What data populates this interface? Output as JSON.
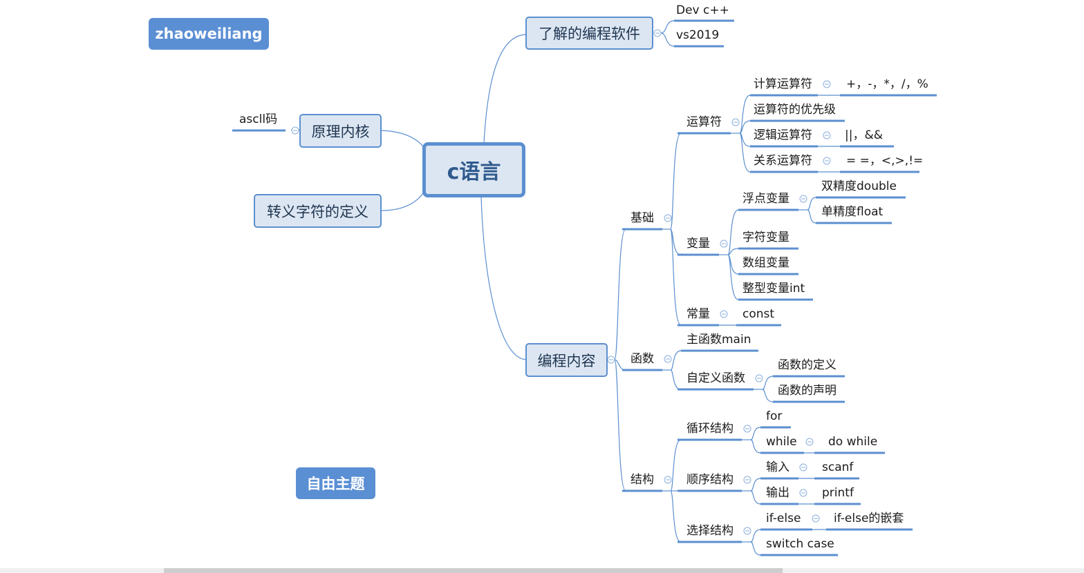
{
  "colors": {
    "line": "#5b8fcf",
    "node_fill": "#dce6f2",
    "floating_fill": "#5b8fd4"
  },
  "floating_topics": {
    "author": "zhaoweiliang",
    "free_topic": "自由主题"
  },
  "central": "c语言",
  "left": {
    "principle": {
      "label": "原理内核",
      "children": [
        "ascll码"
      ]
    },
    "escape": {
      "label": "转义字符的定义"
    }
  },
  "software": {
    "label": "了解的编程软件",
    "children": [
      "Dev c++",
      "vs2019"
    ]
  },
  "content": {
    "label": "编程内容",
    "basics": {
      "label": "基础",
      "operators": {
        "label": "运算符",
        "arith": {
          "label": "计算运算符",
          "value": "+，-，*，/，%"
        },
        "priority": "运算符的优先级",
        "logic": {
          "label": "逻辑运算符",
          "value": "||，&&"
        },
        "relation": {
          "label": "关系运算符",
          "value": "= =，<,>,!="
        }
      },
      "variables": {
        "label": "变量",
        "float": {
          "label": "浮点变量",
          "children": [
            "双精度double",
            "单精度float"
          ]
        },
        "char": "字符变量",
        "array": "数组变量",
        "int": "整型变量int"
      },
      "constants": {
        "label": "常量",
        "value": "const"
      }
    },
    "functions": {
      "label": "函数",
      "main": "主函数main",
      "custom": {
        "label": "自定义函数",
        "children": [
          "函数的定义",
          "函数的声明"
        ]
      }
    },
    "structures": {
      "label": "结构",
      "loop": {
        "label": "循环结构",
        "for": "for",
        "while": "while",
        "do_while": "do while"
      },
      "sequence": {
        "label": "顺序结构",
        "input": "输入",
        "scanf": "scanf",
        "output": "输出",
        "printf": "printf"
      },
      "selection": {
        "label": "选择结构",
        "if_else": "if-else",
        "nested": "if-else的嵌套",
        "switch": "switch case"
      }
    }
  }
}
